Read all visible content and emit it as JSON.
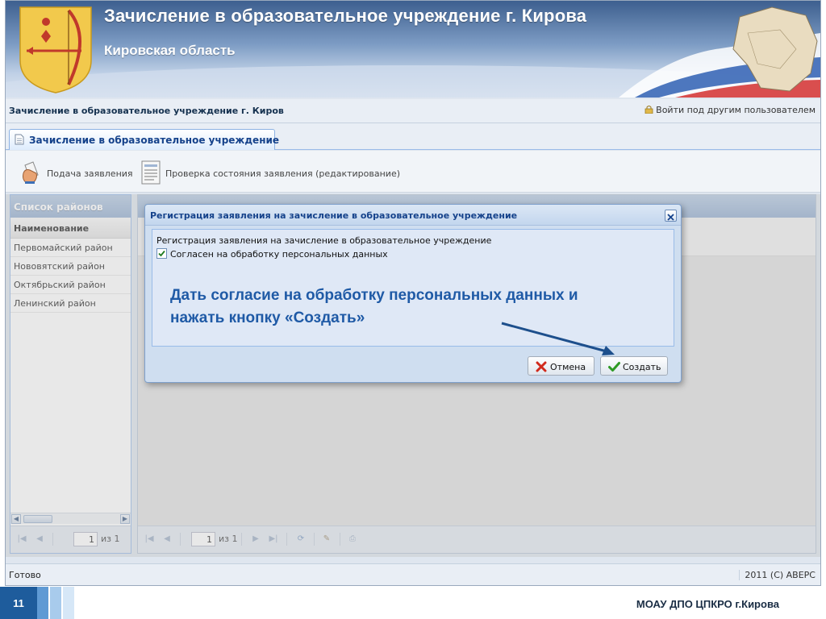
{
  "banner": {
    "title": "Зачисление в образовательное учреждение г. Кирова",
    "subtitle": "Кировская область"
  },
  "topbar": {
    "breadcrumb": "Зачисление в образовательное учреждение г. Киров",
    "login_other": "Войти под другим пользователем"
  },
  "tabs": [
    {
      "label": "Зачисление в образовательное учреждение",
      "icon": "document-icon",
      "active": true
    }
  ],
  "toolbar": {
    "submit_label": "Подача заявления",
    "submit_icon": "hand-paper-icon",
    "check_label": "Проверка состояния заявления (редактирование)",
    "check_icon": "form-list-icon"
  },
  "districts": {
    "panel_title": "Список районов",
    "column_header": "Наименование",
    "items": [
      "Первомайский район",
      "Нововятский район",
      "Октябрьский район",
      "Ленинский район"
    ],
    "pager": {
      "page": "1",
      "of_label": "из 1"
    }
  },
  "right_pager": {
    "page": "1",
    "of_label": "из 1"
  },
  "dialog": {
    "title": "Регистрация заявления на зачисление в образовательное учреждение",
    "body_text": "Регистрация заявления на зачисление в образовательное учреждение",
    "consent_label": "Согласен на обработку персональных данных",
    "consent_checked": true,
    "instruction": "Дать согласие на обработку персональных данных и нажать кнопку «Создать»",
    "cancel_label": "Отмена",
    "create_label": "Создать"
  },
  "status": {
    "text": "Готово",
    "copyright": "2011 (С) АВЕРС"
  },
  "slide": {
    "number": "11",
    "organization": "МОАУ ДПО ЦПКРО г.Кирова"
  },
  "colors": {
    "accent_blue": "#15428b",
    "instruction_blue": "#1f5aa6",
    "panel_header": "#96b0d2",
    "arrow": "#1d4f8c",
    "slide_blue": "#1e5c9c"
  }
}
